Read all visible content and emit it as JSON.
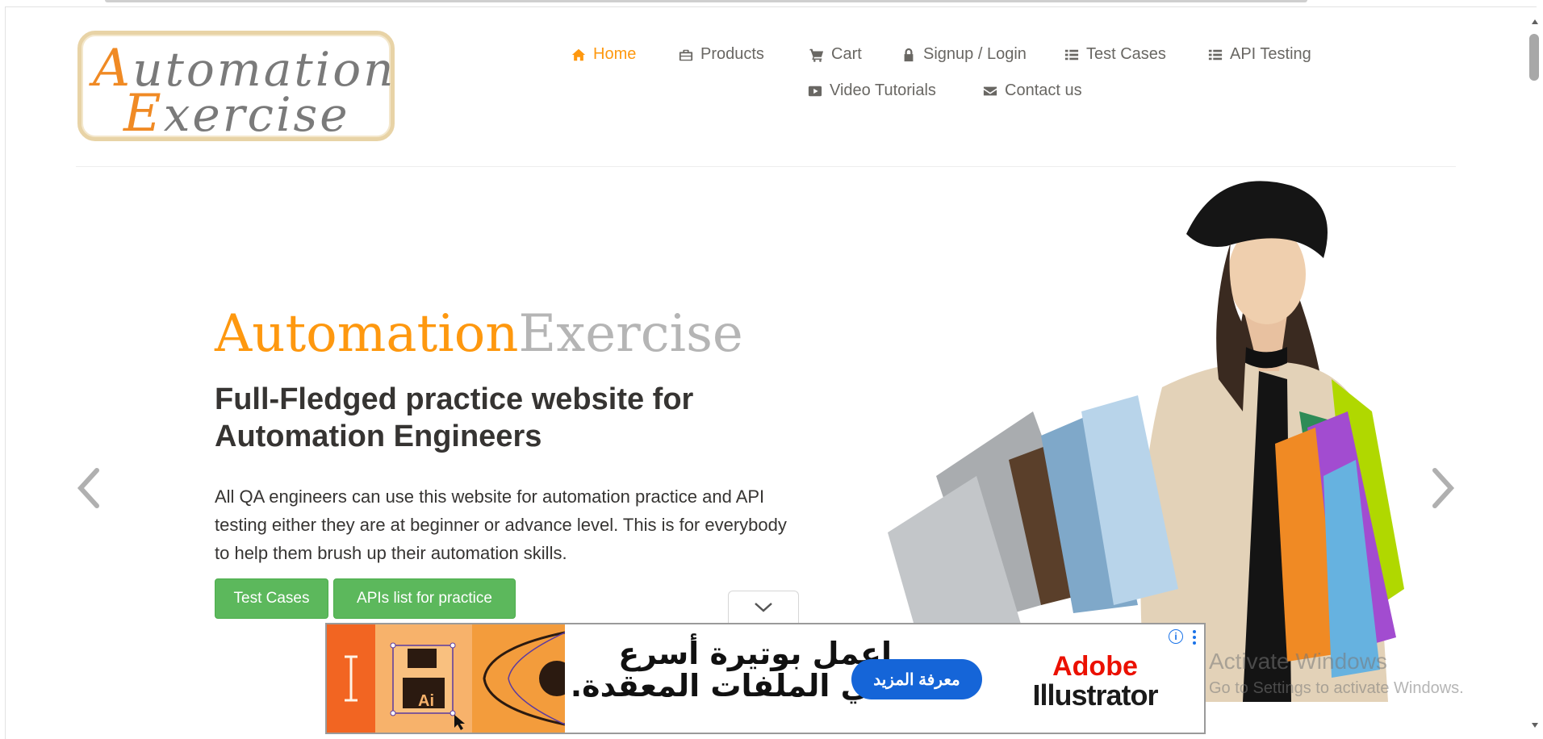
{
  "logo": {
    "line1_cap": "A",
    "line1_rest": "utomation",
    "line2_cap": "E",
    "line2_rest": "xercise"
  },
  "nav": {
    "items": [
      {
        "label": "Home",
        "icon": "home-icon",
        "active": true
      },
      {
        "label": "Products",
        "icon": "briefcase-icon"
      },
      {
        "label": "Cart",
        "icon": "cart-icon"
      },
      {
        "label": "Signup / Login",
        "icon": "lock-icon"
      },
      {
        "label": "Test Cases",
        "icon": "list-icon"
      },
      {
        "label": "API Testing",
        "icon": "list-icon"
      },
      {
        "label": "Video Tutorials",
        "icon": "youtube-play-icon"
      },
      {
        "label": "Contact us",
        "icon": "envelope-icon"
      }
    ]
  },
  "hero": {
    "title_part1": "Automation",
    "title_part2": "Exercise",
    "subtitle": "Full-Fledged practice website for Automation Engineers",
    "description": "All QA engineers can use this website for automation practice and API testing either they are at beginner or advance level. This is for everybody to help them brush up their automation skills.",
    "btn_test_cases": "Test Cases",
    "btn_apis": "APIs list for practice"
  },
  "ad": {
    "headline": "اعمل بوتيرة أسرع في الملفات المعقدة.",
    "cta": "معرفة المزيد",
    "brand_line1": "Adobe",
    "brand_line2": "Illustrator",
    "art_label": "Ai",
    "info": "i"
  },
  "watermark": {
    "line1": "Activate Windows",
    "line2": "Go to Settings to activate Windows."
  },
  "colors": {
    "accent": "#fe980f",
    "button_green": "#5cb85c",
    "ad_cta_blue": "#1565d8",
    "adobe_red": "#eb1000"
  }
}
